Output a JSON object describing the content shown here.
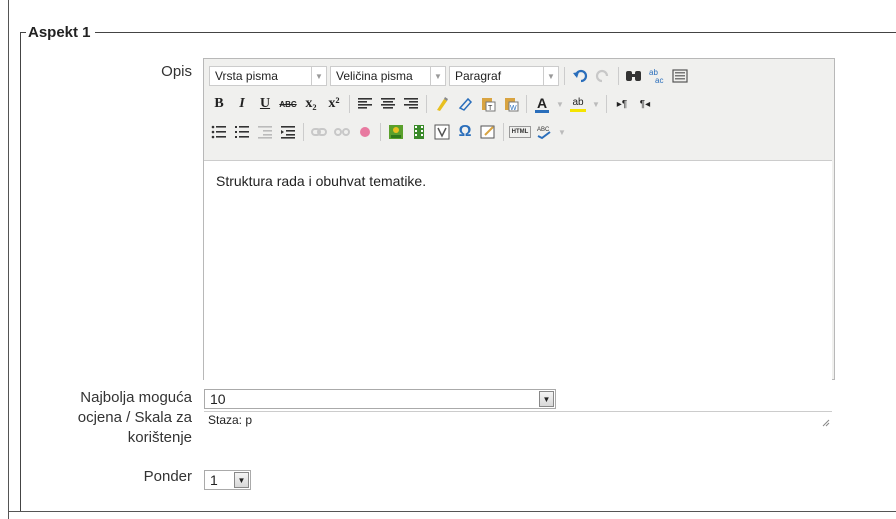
{
  "fieldset": {
    "legend": "Aspekt 1"
  },
  "editor": {
    "label": "Opis",
    "font_family": "Vrsta pisma",
    "font_size": "Veličina pisma",
    "paragraph": "Paragraf",
    "content": "Struktura rada i obuhvat tematike.",
    "status_path": "Staza: p",
    "toolbar_icons": {
      "row1": [
        "undo-icon",
        "redo-icon",
        "find-icon",
        "replace-icon",
        "fullscreen-icon"
      ],
      "row2": [
        "bold-icon",
        "italic-icon",
        "underline-icon",
        "strikethrough-icon",
        "subscript-icon",
        "superscript-icon",
        "align-left-icon",
        "align-center-icon",
        "align-right-icon",
        "cleanup-icon",
        "remove-format-icon",
        "paste-text-icon",
        "paste-word-icon",
        "text-color-icon",
        "highlight-color-icon",
        "ltr-icon",
        "rtl-icon"
      ],
      "row3": [
        "bullet-list-icon",
        "numbered-list-icon",
        "outdent-icon",
        "indent-icon",
        "link-icon",
        "unlink-icon",
        "anchor-icon",
        "image-icon",
        "media-icon",
        "emoticon-icon",
        "special-char-icon",
        "nonbreaking-icon",
        "html-icon",
        "spellcheck-icon"
      ]
    },
    "glyphs": {
      "bold": "B",
      "italic": "I",
      "underline": "U",
      "strike": "ABC",
      "subscript": "x₂",
      "superscript": "x²",
      "text_color": "A",
      "highlight": "ab",
      "special": "Ω",
      "html": "HTML"
    }
  },
  "grade": {
    "label_line1": "Najbolja moguća",
    "label_line2": "ocjena / Skala za",
    "label_line3": "korištenje",
    "value": "10"
  },
  "weight": {
    "label": "Ponder",
    "value": "1"
  },
  "colors": {
    "border": "#444444",
    "toolbar_bg": "#f0f0ee",
    "link_blue": "#2a6ebb"
  }
}
